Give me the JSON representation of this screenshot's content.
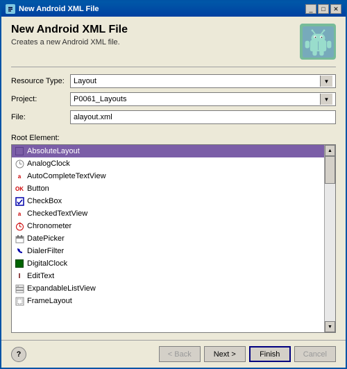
{
  "window": {
    "title": "New Android XML File",
    "title_icon": "✦"
  },
  "header": {
    "title": "New Android XML File",
    "description": "Creates a new Android XML file.",
    "logo_alt": "Android logo"
  },
  "form": {
    "resource_type_label": "Resource Type:",
    "resource_type_value": "Layout",
    "project_label": "Project:",
    "project_value": "P0061_Layouts",
    "file_label": "File:",
    "file_value": "alayout.xml"
  },
  "list": {
    "section_label": "Root Element:",
    "items": [
      {
        "id": "AbsoluteLayout",
        "label": "AbsoluteLayout",
        "icon_type": "box",
        "selected": true
      },
      {
        "id": "AnalogClock",
        "label": "AnalogClock",
        "icon_type": "clock"
      },
      {
        "id": "AutoCompleteTextView",
        "label": "AutoCompleteTextView",
        "icon_type": "a-red"
      },
      {
        "id": "Button",
        "label": "Button",
        "icon_type": "ok-red"
      },
      {
        "id": "CheckBox",
        "label": "CheckBox",
        "icon_type": "check"
      },
      {
        "id": "CheckedTextView",
        "label": "CheckedTextView",
        "icon_type": "a-red"
      },
      {
        "id": "Chronometer",
        "label": "Chronometer",
        "icon_type": "chrono"
      },
      {
        "id": "DatePicker",
        "label": "DatePicker",
        "icon_type": "date"
      },
      {
        "id": "DialerFilter",
        "label": "DialerFilter",
        "icon_type": "phone"
      },
      {
        "id": "DigitalClock",
        "label": "DigitalClock",
        "icon_type": "green-box"
      },
      {
        "id": "EditText",
        "label": "EditText",
        "icon_type": "t-text"
      },
      {
        "id": "ExpandableListView",
        "label": "ExpandableListView",
        "icon_type": "expand"
      },
      {
        "id": "FrameLayout",
        "label": "FrameLayout",
        "icon_type": "frame"
      }
    ]
  },
  "buttons": {
    "back": "< Back",
    "next": "Next >",
    "finish": "Finish",
    "cancel": "Cancel",
    "help": "?"
  }
}
